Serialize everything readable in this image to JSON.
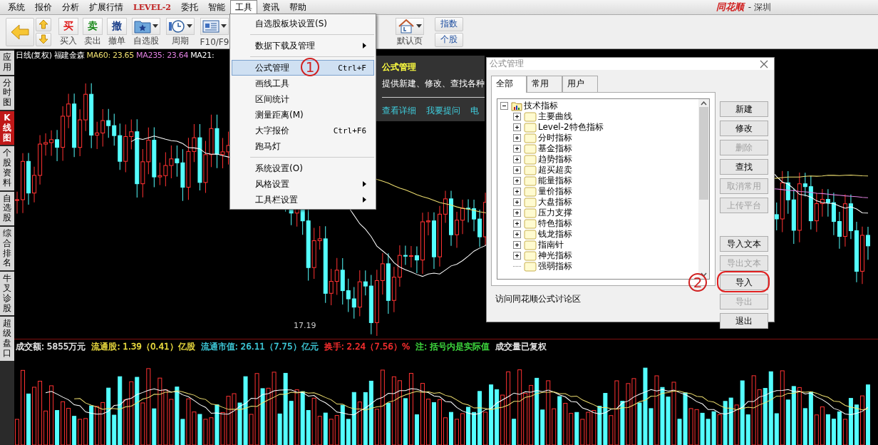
{
  "menu_bar": [
    {
      "label": "系统",
      "selected": false
    },
    {
      "label": "报价",
      "selected": false
    },
    {
      "label": "分析",
      "selected": false
    },
    {
      "label": "扩展行情",
      "selected": false
    },
    {
      "label": "LEVEL-2",
      "selected": false,
      "kind": "special"
    },
    {
      "label": "委托",
      "selected": false
    },
    {
      "label": "智能",
      "selected": false
    },
    {
      "label": "工具",
      "selected": true
    },
    {
      "label": "资讯",
      "selected": false
    },
    {
      "label": "帮助",
      "selected": false
    }
  ],
  "title": {
    "logo": "同花顺",
    "text": "- 深圳"
  },
  "toolbar": [
    {
      "kind": "back"
    },
    {
      "kind": "updown"
    },
    {
      "kind": "trade",
      "glyph": "买",
      "label": "买入",
      "color": "#e02020"
    },
    {
      "kind": "trade",
      "glyph": "卖",
      "label": "卖出",
      "color": "#1a8a1a"
    },
    {
      "kind": "trade",
      "glyph": "撤",
      "label": "撤单",
      "color": "#1a3f8a"
    },
    {
      "kind": "favorites",
      "label": "自选股"
    },
    {
      "kind": "period",
      "label": "周期"
    },
    {
      "kind": "f10",
      "label": "F10/F9"
    },
    {
      "kind": "home",
      "label": "默认页"
    },
    {
      "kind": "switch",
      "labels": [
        "指数",
        "个股"
      ]
    }
  ],
  "sidebar": [
    {
      "label": "应用",
      "selected": false
    },
    {
      "label": "分时图",
      "selected": false
    },
    {
      "label": "K线图",
      "selected": true
    },
    {
      "label": "个股资料",
      "selected": false
    },
    {
      "label": "自选股",
      "selected": false
    },
    {
      "label": "综合排名",
      "selected": false
    },
    {
      "label": "牛叉诊股",
      "selected": false
    },
    {
      "label": "超级盘口",
      "selected": false
    }
  ],
  "chart_header": {
    "period": "日线(复权)",
    "stock": "福建金森",
    "indicators": [
      {
        "text": "MA60: 23.65",
        "color": "#f0e070"
      },
      {
        "text": "MA235: 23.64",
        "color": "#e080e0"
      },
      {
        "text": "MA21:",
        "color": "#ffffff"
      }
    ]
  },
  "price_labels": {
    "low": "17.19"
  },
  "info_line": [
    {
      "text": "成交额: 5855万元",
      "color": "#e8e8e8"
    },
    {
      "text": "流通股: 1.39（0.41）亿股",
      "color": "#f0e040"
    },
    {
      "text": "流通市值: 26.11（7.75）亿元",
      "color": "#40d0e0"
    },
    {
      "text": "换手: 2.24（7.56）%",
      "color": "#ff3030"
    },
    {
      "text": "注: 括号内是实际值",
      "color": "#40e040"
    },
    {
      "text": "成交量已复权",
      "color": "#e8e8e8"
    }
  ],
  "tools_menu": [
    {
      "kind": "item",
      "label": "自选股板块设置(S)",
      "selected": false
    },
    {
      "kind": "separator"
    },
    {
      "kind": "item",
      "label": "数据下载及管理",
      "submenu": true,
      "selected": false
    },
    {
      "kind": "separator"
    },
    {
      "kind": "item",
      "label": "公式管理",
      "shortcut": "Ctrl+F",
      "selected": true,
      "annotation": "1"
    },
    {
      "kind": "item",
      "label": "画线工具",
      "selected": false
    },
    {
      "kind": "item",
      "label": "区间统计",
      "selected": false
    },
    {
      "kind": "item",
      "label": "测量距离(M)",
      "selected": false
    },
    {
      "kind": "item",
      "label": "大字报价",
      "shortcut": "Ctrl+F6",
      "selected": false
    },
    {
      "kind": "item",
      "label": "跑马灯",
      "selected": false
    },
    {
      "kind": "separator"
    },
    {
      "kind": "item",
      "label": "系统设置(O)",
      "selected": false
    },
    {
      "kind": "item",
      "label": "风格设置",
      "submenu": true,
      "selected": false
    },
    {
      "kind": "item",
      "label": "工具栏设置",
      "submenu": true,
      "selected": false
    }
  ],
  "tooltip": {
    "title": "公式管理",
    "description": "提供新建、修改、查找各种",
    "links": [
      "查看详细",
      "我要提问",
      "电"
    ]
  },
  "dialog": {
    "title": "公式管理",
    "tabs": [
      {
        "label": "全部",
        "selected": true
      },
      {
        "label": "常用",
        "selected": false
      },
      {
        "label": "用户",
        "selected": false
      }
    ],
    "tree": [
      {
        "label": "技术指标",
        "expanded": true,
        "children": [
          {
            "label": "主要曲线",
            "expandable": true
          },
          {
            "label": "Level-2特色指标",
            "expandable": true
          },
          {
            "label": "分时指标",
            "expandable": true
          },
          {
            "label": "基金指标",
            "expandable": true
          },
          {
            "label": "趋势指标",
            "expandable": true
          },
          {
            "label": "超买超卖",
            "expandable": true
          },
          {
            "label": "能量指标",
            "expandable": true
          },
          {
            "label": "量价指标",
            "expandable": true
          },
          {
            "label": "大盘指标",
            "expandable": true
          },
          {
            "label": "压力支撑",
            "expandable": true
          },
          {
            "label": "特色指标",
            "expandable": true
          },
          {
            "label": "钱龙指标",
            "expandable": true
          },
          {
            "label": "指南针",
            "expandable": true
          },
          {
            "label": "神光指标",
            "expandable": true
          },
          {
            "label": "强弱指标",
            "expandable": false
          }
        ]
      }
    ],
    "buttons": [
      {
        "label": "新建",
        "disabled": false
      },
      {
        "label": "修改",
        "disabled": false
      },
      {
        "label": "删除",
        "disabled": true
      },
      {
        "label": "查找",
        "disabled": false
      },
      {
        "label": "取消常用",
        "disabled": true
      },
      {
        "label": "上传平台",
        "disabled": true
      },
      {
        "kind": "gap"
      },
      {
        "label": "导入文本",
        "disabled": false
      },
      {
        "label": "导出文本",
        "disabled": true
      },
      {
        "label": "导入",
        "disabled": false,
        "annotation": "2"
      },
      {
        "label": "导出",
        "disabled": true
      },
      {
        "label": "退出",
        "disabled": false
      }
    ],
    "footer_link": "访问同花顺公式讨论区"
  }
}
